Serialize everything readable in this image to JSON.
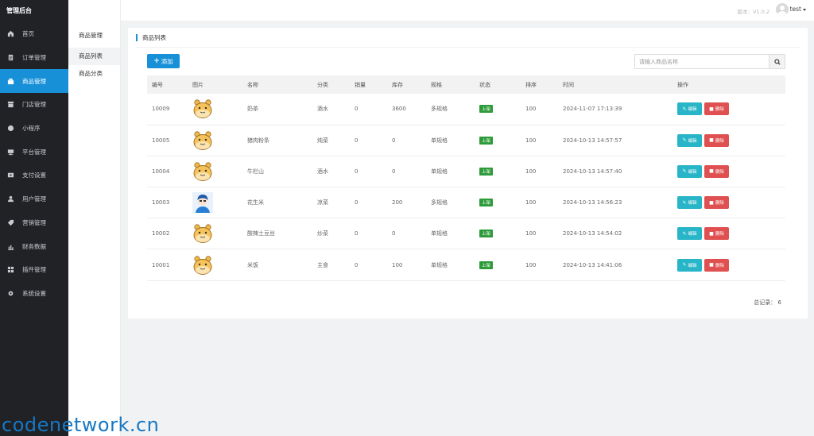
{
  "app": {
    "title": "管理后台"
  },
  "sidebar": {
    "items": [
      {
        "label": "首页",
        "icon": "home-icon"
      },
      {
        "label": "订单管理",
        "icon": "order-icon"
      },
      {
        "label": "商品管理",
        "icon": "goods-icon",
        "active": true
      },
      {
        "label": "门店管理",
        "icon": "store-icon"
      },
      {
        "label": "小程序",
        "icon": "miniprogram-icon"
      },
      {
        "label": "平台管理",
        "icon": "platform-icon"
      },
      {
        "label": "支付设置",
        "icon": "payment-icon"
      },
      {
        "label": "用户管理",
        "icon": "user-icon"
      },
      {
        "label": "营销管理",
        "icon": "tag-icon"
      },
      {
        "label": "财务数据",
        "icon": "chart-icon"
      },
      {
        "label": "插件管理",
        "icon": "plugin-icon"
      },
      {
        "label": "系统设置",
        "icon": "gear-icon"
      }
    ]
  },
  "subnav": {
    "title": "商品管理",
    "items": [
      {
        "label": "商品列表",
        "active": true
      },
      {
        "label": "商品分类"
      }
    ]
  },
  "topbar": {
    "version": "版本：V1.0.2",
    "username": "test"
  },
  "panel": {
    "title": "商品列表",
    "add_label": "添加",
    "search_placeholder": "请输入商品名称"
  },
  "table": {
    "headers": [
      "编号",
      "图片",
      "名称",
      "分类",
      "销量",
      "库存",
      "规格",
      "状态",
      "排序",
      "时间",
      "操作"
    ],
    "rows": [
      {
        "id": "10009",
        "image": "bear",
        "name": "奶茶",
        "category": "酒水",
        "sales": "0",
        "stock": "3600",
        "spec": "多规格",
        "status": "上架",
        "sort": "100",
        "time": "2024-11-07 17:13:39"
      },
      {
        "id": "10005",
        "image": "bear",
        "name": "猪肉粉条",
        "category": "炖菜",
        "sales": "0",
        "stock": "0",
        "spec": "单规格",
        "status": "上架",
        "sort": "100",
        "time": "2024-10-13 14:57:57"
      },
      {
        "id": "10004",
        "image": "bear",
        "name": "牛栏山",
        "category": "酒水",
        "sales": "0",
        "stock": "0",
        "spec": "单规格",
        "status": "上架",
        "sort": "100",
        "time": "2024-10-13 14:57:40"
      },
      {
        "id": "10003",
        "image": "person",
        "name": "花生米",
        "category": "凉菜",
        "sales": "0",
        "stock": "200",
        "spec": "多规格",
        "status": "上架",
        "sort": "100",
        "time": "2024-10-13 14:56:23"
      },
      {
        "id": "10002",
        "image": "bear",
        "name": "酸辣土豆丝",
        "category": "炒菜",
        "sales": "0",
        "stock": "0",
        "spec": "单规格",
        "status": "上架",
        "sort": "100",
        "time": "2024-10-13 14:54:02"
      },
      {
        "id": "10001",
        "image": "bear",
        "name": "米饭",
        "category": "主食",
        "sales": "0",
        "stock": "100",
        "spec": "单规格",
        "status": "上架",
        "sort": "100",
        "time": "2024-10-13 14:41:06"
      }
    ],
    "edit_label": "编辑",
    "delete_label": "删除",
    "total_label": "总记录：",
    "total": "6"
  },
  "colors": {
    "accent": "#1790d8",
    "sidebar_bg": "#202226",
    "multi_spec": "#e53b3b",
    "single_spec": "#4caf50",
    "status_on": "#2e9b3b",
    "edit": "#28b5c8",
    "delete": "#e05050"
  },
  "watermark": "codenetwork.cn"
}
